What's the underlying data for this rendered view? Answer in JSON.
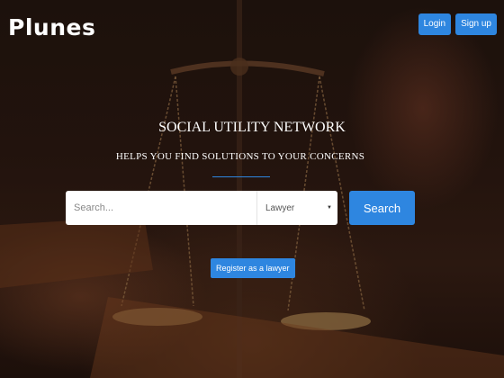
{
  "header": {
    "logo": "Plunes",
    "login_label": "Login",
    "signup_label": "Sign up"
  },
  "hero": {
    "title": "SOCIAL UTILITY NETWORK",
    "subtitle": "HELPS YOU FIND SOLUTIONS TO YOUR CONCERNS"
  },
  "search": {
    "placeholder": "Search...",
    "category_selected": "Lawyer",
    "button_label": "Search"
  },
  "register": {
    "label": "Register as a lawyer"
  },
  "colors": {
    "accent": "#2e86e0"
  }
}
